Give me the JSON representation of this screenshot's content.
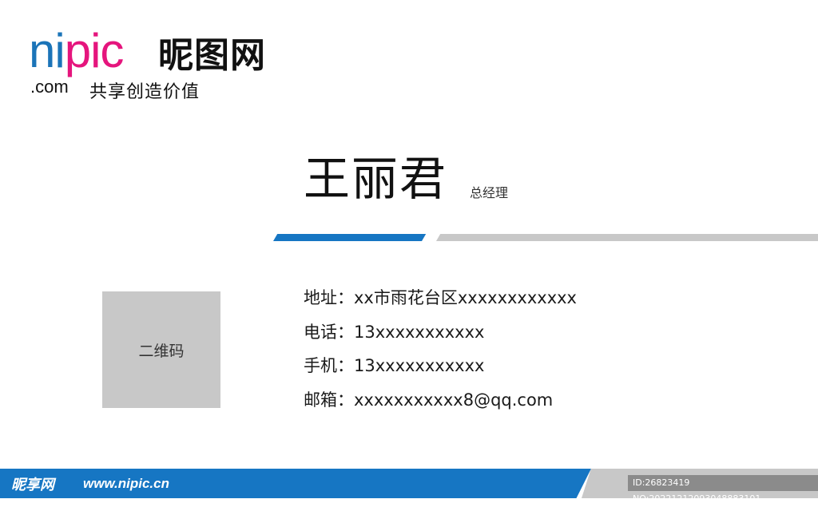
{
  "logo": {
    "nipic_part1": "ni",
    "nipic_part2": "pic",
    "chinese_name": "昵图网",
    "domain": ".com",
    "slogan": "共享创造价值",
    "colors": {
      "blue": "#1b74b8",
      "magenta": "#e5157d"
    }
  },
  "card": {
    "name": "王丽君",
    "title": "总经理",
    "qr_label": "二维码",
    "contacts": [
      {
        "label": "地址：",
        "value": "xx市雨花台区xxxxxxxxxxxx"
      },
      {
        "label": "电话：",
        "value": "13xxxxxxxxxxx"
      },
      {
        "label": "手机：",
        "value": "13xxxxxxxxxxx"
      },
      {
        "label": "邮箱：",
        "value": "xxxxxxxxxxx8@qq.com"
      }
    ],
    "accent_colors": {
      "blue": "#1676c3",
      "gray": "#c8c8c8"
    }
  },
  "footer": {
    "brand": "昵享网",
    "url": "www.nipic.cn",
    "id_text": "ID:26823419 NO:20221212093048883101"
  }
}
